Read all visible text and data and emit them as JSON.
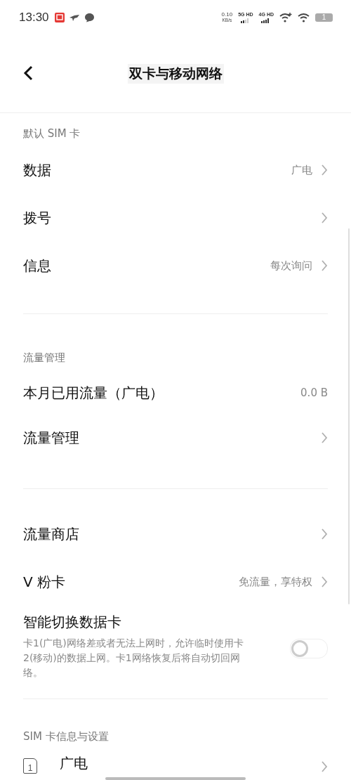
{
  "status_bar": {
    "time": "13:30",
    "net_speed": "0.10",
    "net_unit": "KB/s",
    "sim_1_network": "5G HD",
    "sim_2_network": "4G HD",
    "battery": "1"
  },
  "header": {
    "title": "双卡与移动网络"
  },
  "sections": [
    {
      "label": "默认 SIM 卡",
      "items": [
        {
          "kind": "nav",
          "title": "数据",
          "value": "广电"
        },
        {
          "kind": "nav",
          "title": "拨号"
        },
        {
          "kind": "nav",
          "title": "信息",
          "value": "每次询问"
        }
      ]
    },
    {
      "label": "流量管理",
      "items": [
        {
          "kind": "value",
          "title": "本月已用流量（广电）",
          "value": "0.0 B"
        },
        {
          "kind": "nav",
          "title": "流量管理"
        }
      ]
    },
    {
      "items": [
        {
          "kind": "nav",
          "title": "流量商店"
        },
        {
          "kind": "nav",
          "title": "V 粉卡",
          "value": "免流量，享特权"
        },
        {
          "kind": "toggle",
          "title": "智能切换数据卡",
          "description": "卡1(广电)网络差或者无法上网时，允许临时使用卡2(移动)的数据上网。卡1网络恢复后将自动切回网络。",
          "on": false
        }
      ]
    },
    {
      "label": "SIM 卡信息与设置",
      "items": [
        {
          "kind": "sim",
          "slot": "1",
          "title": "广电"
        }
      ]
    }
  ]
}
